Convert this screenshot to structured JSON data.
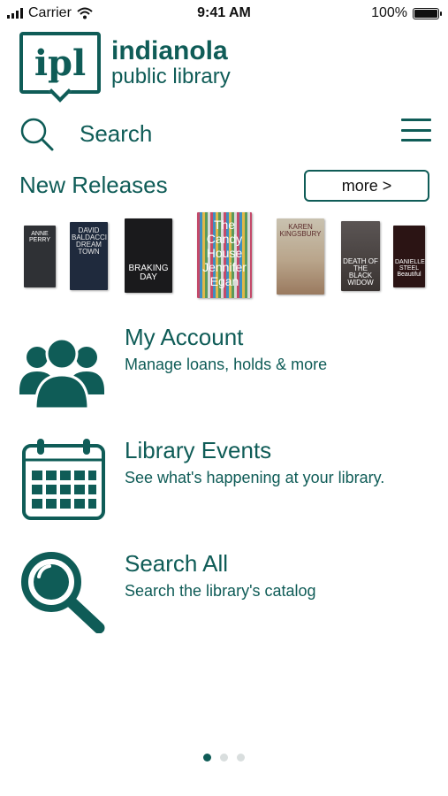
{
  "status_bar": {
    "carrier": "Carrier",
    "time": "9:41 AM",
    "battery": "100%"
  },
  "logo": {
    "badge": "ipl",
    "line1": "indianola",
    "line2": "public library"
  },
  "search": {
    "label": "Search",
    "icon": "search-icon"
  },
  "menu_icon": "hamburger-menu-icon",
  "new_releases": {
    "title": "New Releases",
    "more_label": "more >",
    "books": [
      {
        "title_text": "ANNE PERRY",
        "color": "#2f3135"
      },
      {
        "title_text": "DAVID BALDACCI DREAM TOWN",
        "color": "#1f2a3d"
      },
      {
        "title_text": "BRAKING DAY",
        "color": "#1a1a1c"
      },
      {
        "title_text": "The Candy House Jennifer Egan",
        "color": "#c46a7c"
      },
      {
        "title_text": "KAREN KINGSBURY",
        "color": "#b9a58b"
      },
      {
        "title_text": "DEATH OF THE BLACK WIDOW",
        "color": "#3a3432"
      },
      {
        "title_text": "DANIELLE STEEL Beautiful",
        "color": "#2b1414"
      }
    ]
  },
  "items": [
    {
      "title": "My Account",
      "subtitle": "Manage loans, holds & more",
      "icon": "users-icon"
    },
    {
      "title": "Library Events",
      "subtitle": "See what's happening at your library.",
      "icon": "calendar-icon"
    },
    {
      "title": "Search All",
      "subtitle": "Search the library's catalog",
      "icon": "magnifier-icon"
    }
  ],
  "pagination": {
    "pages": 3,
    "active": 1
  },
  "colors": {
    "brand": "#0f5c57",
    "dot_inactive": "#d9dede"
  }
}
